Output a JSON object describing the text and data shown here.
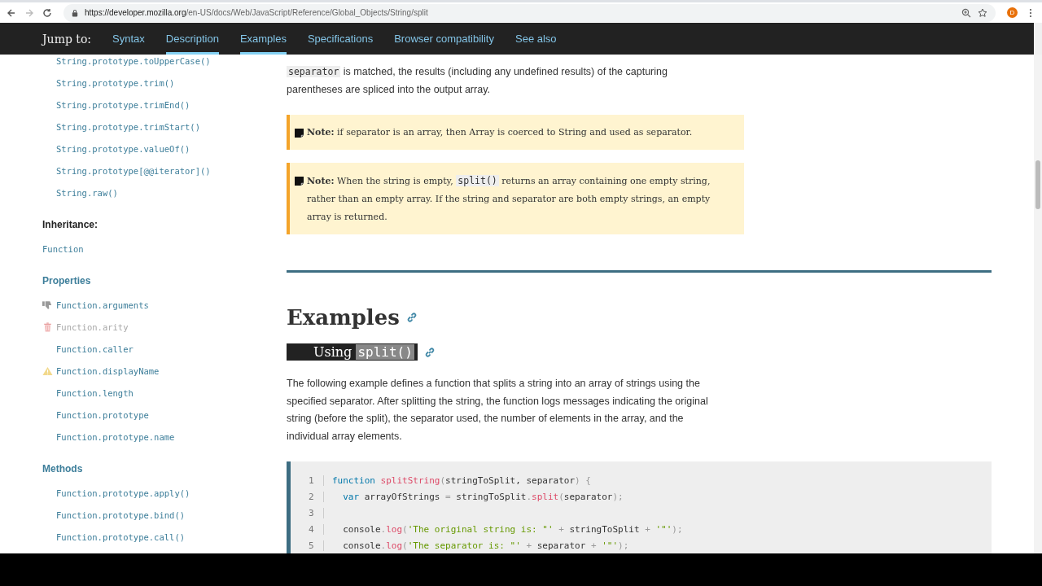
{
  "browser": {
    "url_host": "https://developer.mozilla.org",
    "url_path": "/en-US/docs/Web/JavaScript/Reference/Global_Objects/String/split",
    "profile": "D"
  },
  "jump_bar": {
    "label": "Jump to:",
    "links": [
      {
        "label": "Syntax",
        "selected": false
      },
      {
        "label": "Description",
        "selected": true
      },
      {
        "label": "Examples",
        "selected": true
      },
      {
        "label": "Specifications",
        "selected": false
      },
      {
        "label": "Browser compatibility",
        "selected": false
      },
      {
        "label": "See also",
        "selected": false
      }
    ]
  },
  "sidebar": {
    "sections": [
      {
        "items": [
          {
            "label": "String.prototype.toUpperCase()",
            "kind": "plain"
          },
          {
            "label": "String.prototype.trim()",
            "kind": "plain"
          },
          {
            "label": "String.prototype.trimEnd()",
            "kind": "plain"
          },
          {
            "label": "String.prototype.trimStart()",
            "kind": "plain"
          },
          {
            "label": "String.prototype.valueOf()",
            "kind": "plain"
          },
          {
            "label": "String.prototype[@@iterator]()",
            "kind": "plain"
          },
          {
            "label": "String.raw()",
            "kind": "plain"
          }
        ]
      },
      {
        "heading": "Inheritance:",
        "kind": "label",
        "items": [
          {
            "label": "Function",
            "kind": "top"
          }
        ]
      },
      {
        "heading": "Properties",
        "kind": "link",
        "items": [
          {
            "label": "Function.arguments",
            "kind": "deprecated"
          },
          {
            "label": "Function.arity",
            "kind": "obsolete"
          },
          {
            "label": "Function.caller",
            "kind": "plain"
          },
          {
            "label": "Function.displayName",
            "kind": "experimental"
          },
          {
            "label": "Function.length",
            "kind": "plain"
          },
          {
            "label": "Function.prototype",
            "kind": "plain"
          },
          {
            "label": "Function.prototype.name",
            "kind": "plain"
          }
        ]
      },
      {
        "heading": "Methods",
        "kind": "link",
        "items": [
          {
            "label": "Function.prototype.apply()",
            "kind": "plain"
          },
          {
            "label": "Function.prototype.bind()",
            "kind": "plain"
          },
          {
            "label": "Function.prototype.call()",
            "kind": "plain"
          }
        ]
      }
    ]
  },
  "content": {
    "intro": [
      {
        "text": "separator",
        "code": true
      },
      {
        "text": " is matched, the results (including any undefined results) of the capturing parentheses are spliced into the output array.",
        "code": false
      }
    ],
    "notes": [
      {
        "label": "Note:",
        "parts": [
          {
            "text": "if separator is an array, then Array is coerced to String and used as separator.",
            "code": false
          }
        ]
      },
      {
        "label": "Note:",
        "parts": [
          {
            "text": "When the string is empty, ",
            "code": false
          },
          {
            "text": "split()",
            "code": true
          },
          {
            "text": " returns an array containing one empty string, rather than an empty array. If the string and separator are both empty strings, an empty array is returned.",
            "code": false
          }
        ]
      }
    ],
    "heading": "Examples",
    "subheading": {
      "text": "Using",
      "code": "split()",
      "highlighted": true
    },
    "paragraph": "The following example defines a function that splits a string into an array of strings using the specified separator. After splitting the string, the function logs messages indicating the original string (before the split), the separator used, the number of elements in the array, and the individual array elements.",
    "code_lines": [
      {
        "number": "1",
        "tokens": [
          {
            "text": "function ",
            "kind": "keyword"
          },
          {
            "text": "splitString",
            "kind": "func"
          },
          {
            "text": "(",
            "kind": "punct"
          },
          {
            "text": "stringToSplit, separator",
            "kind": "plain"
          },
          {
            "text": ") {",
            "kind": "punct"
          }
        ]
      },
      {
        "number": "2",
        "tokens": [
          {
            "text": "  var ",
            "kind": "keyword"
          },
          {
            "text": "arrayOfStrings ",
            "kind": "plain"
          },
          {
            "text": "= ",
            "kind": "punct"
          },
          {
            "text": "stringToSplit",
            "kind": "plain"
          },
          {
            "text": ".",
            "kind": "punct"
          },
          {
            "text": "split",
            "kind": "func"
          },
          {
            "text": "(",
            "kind": "punct"
          },
          {
            "text": "separator",
            "kind": "plain"
          },
          {
            "text": ");",
            "kind": "punct"
          }
        ]
      },
      {
        "number": "3"
      },
      {
        "number": "4",
        "tokens": [
          {
            "text": "  console",
            "kind": "plain"
          },
          {
            "text": ".",
            "kind": "punct"
          },
          {
            "text": "log",
            "kind": "func"
          },
          {
            "text": "(",
            "kind": "punct"
          },
          {
            "text": "'The original string is: \"'",
            "kind": "string"
          },
          {
            "text": " + ",
            "kind": "punct"
          },
          {
            "text": "stringToSplit",
            "kind": "plain"
          },
          {
            "text": " + ",
            "kind": "punct"
          },
          {
            "text": "'\"'",
            "kind": "string"
          },
          {
            "text": ");",
            "kind": "punct"
          }
        ]
      },
      {
        "number": "5",
        "tokens": [
          {
            "text": "  console",
            "kind": "plain"
          },
          {
            "text": ".",
            "kind": "punct"
          },
          {
            "text": "log",
            "kind": "func"
          },
          {
            "text": "(",
            "kind": "punct"
          },
          {
            "text": "'The separator is: \"'",
            "kind": "string"
          },
          {
            "text": " + ",
            "kind": "punct"
          },
          {
            "text": "separator",
            "kind": "plain"
          },
          {
            "text": " + ",
            "kind": "punct"
          },
          {
            "text": "'\"'",
            "kind": "string"
          },
          {
            "text": ");",
            "kind": "punct"
          }
        ]
      }
    ]
  }
}
